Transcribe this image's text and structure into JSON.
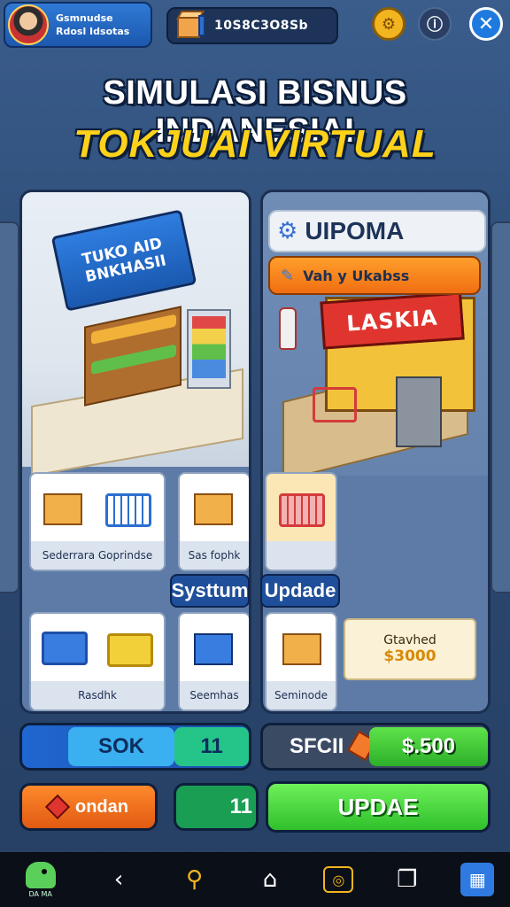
{
  "profile": {
    "line1": "Gsmnudse",
    "line2": "Rdosl Idsotas"
  },
  "coins": {
    "value": "10S8C3O8Sb"
  },
  "top_icons": {
    "settings": "⚙",
    "info": "ⓘ",
    "close": "✕"
  },
  "title": {
    "line1": "SIMULASI BISNUS INDANESIAI",
    "line2": "TOKJUAI  VIRTUAL"
  },
  "left_panel": {
    "sign_line1": "TUKO  AID",
    "sign_line2": "BNKHASII",
    "items": [
      {
        "label": "Sederrara Goprindse"
      },
      {
        "label": "Sas fophk"
      },
      {
        "label": "Rasdhk"
      },
      {
        "label": "Seemhas"
      }
    ],
    "tag": "Systtum"
  },
  "right_panel": {
    "header": "UIPOMA",
    "button": "Vah y Ukabss",
    "store_sign": "LASKIA",
    "tag": "Updade",
    "item_label": "Seminode",
    "price_card": {
      "line1": "Gtavhed",
      "line2": "$3000"
    }
  },
  "bottom": {
    "sok_label": "SOK",
    "sok_value": "11",
    "sfci_label": "SFCII",
    "sfci_value": "$.500",
    "ondan_label": "ondan",
    "mid_value": "11",
    "update_label": "UPDAE"
  },
  "navbar": {
    "logo_text": "DA MA",
    "back": "‹",
    "search": "⚲",
    "home": "⌂",
    "camera": "◎",
    "recent": "❐",
    "apps": "▦"
  },
  "colors": {
    "accent_blue": "#2f7ad6",
    "title_yellow": "#ffd21a",
    "update_green": "#30c02c",
    "orange": "#f06e12"
  }
}
